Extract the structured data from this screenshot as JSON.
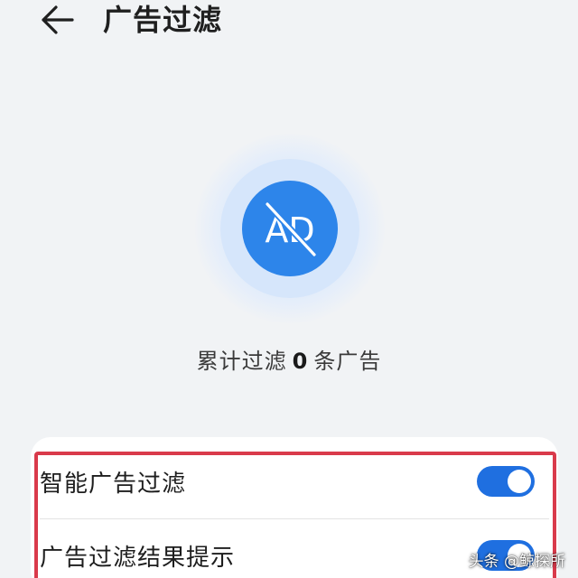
{
  "header": {
    "back_icon": "arrow-left-icon",
    "title": "广告过滤"
  },
  "emblem": {
    "icon": "ad-block-icon",
    "text": "AD",
    "color": "#2d85ea"
  },
  "counter": {
    "prefix": "累计过滤",
    "count": "0",
    "suffix": "条广告"
  },
  "settings": {
    "items": [
      {
        "label": "智能广告过滤",
        "enabled": true
      },
      {
        "label": "广告过滤结果提示",
        "enabled": true
      }
    ]
  },
  "watermark": {
    "text": "头条 @鲸探所"
  },
  "colors": {
    "accent": "#1f6fe0",
    "highlight_border": "#d93a4b",
    "background": "#f1f3f5"
  }
}
